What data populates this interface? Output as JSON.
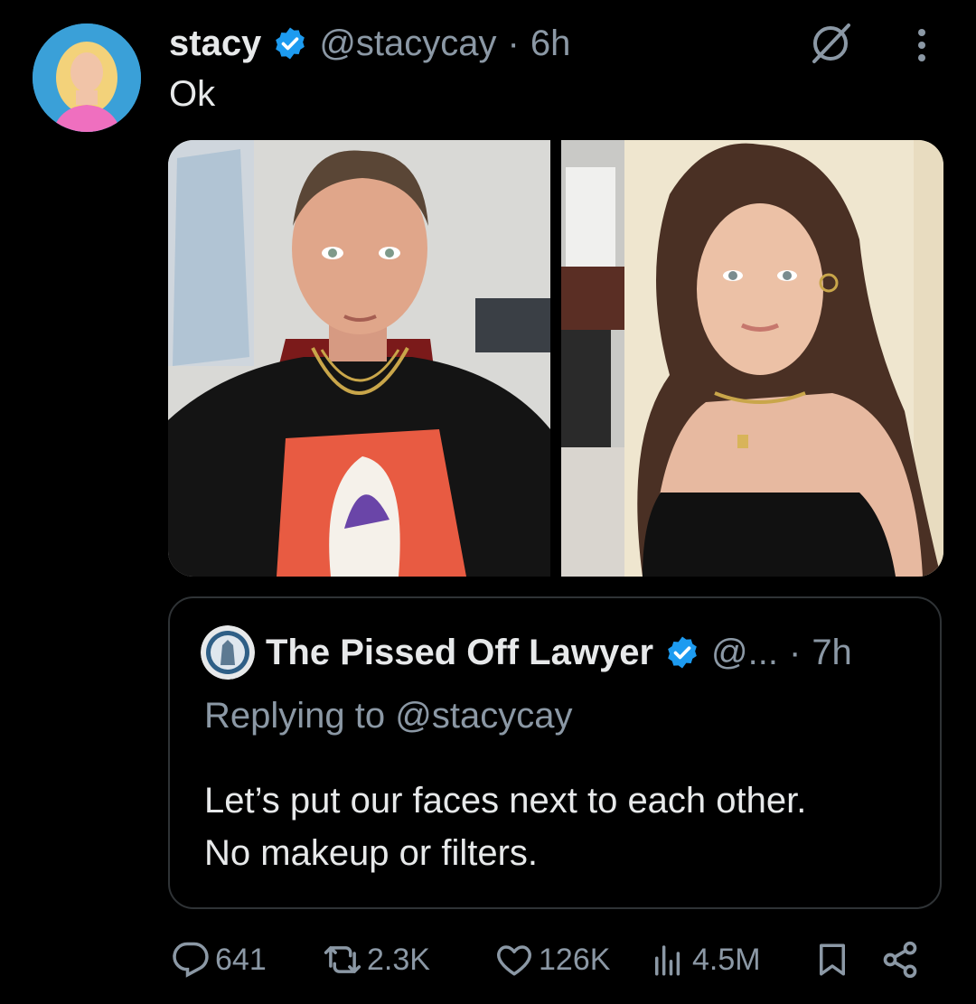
{
  "tweet": {
    "author_name": "stacy",
    "author_handle": "@stacycay",
    "separator": "·",
    "time": "6h",
    "text": "Ok"
  },
  "quoted": {
    "author_name": "The Pissed Off Lawyer",
    "author_handle": "@...",
    "separator": "·",
    "time": "7h",
    "reply_line": "Replying to @stacycay",
    "body_line1": "Let’s put our faces next to each other.",
    "body_line2": "No makeup or filters."
  },
  "actions": {
    "replies": "641",
    "reposts": "2.3K",
    "likes": "126K",
    "views": "4.5M"
  },
  "colors": {
    "background": "#000000",
    "text": "#e7e9ea",
    "secondary": "#8b98a5",
    "verified": "#1d9bf0",
    "border": "#2f3336"
  },
  "icons": [
    "verified-badge-icon",
    "grok-icon",
    "more-icon",
    "reply-icon",
    "repost-icon",
    "like-icon",
    "views-icon",
    "bookmark-icon",
    "share-icon"
  ]
}
